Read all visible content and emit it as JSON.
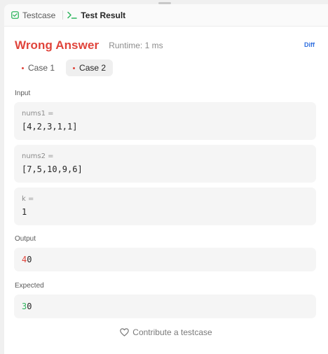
{
  "tabs": [
    {
      "label": "Testcase",
      "icon": "checkbox-icon",
      "active": false
    },
    {
      "label": "Test Result",
      "icon": "terminal-icon",
      "active": true
    }
  ],
  "result": {
    "status": "Wrong Answer",
    "runtime": "Runtime: 1 ms",
    "diff_label": "Diff"
  },
  "cases": [
    {
      "label": "Case 1",
      "active": false
    },
    {
      "label": "Case 2",
      "active": true
    }
  ],
  "input": {
    "label": "Input",
    "params": [
      {
        "name": "nums1 =",
        "value": "[4,2,3,1,1]"
      },
      {
        "name": "nums2 =",
        "value": "[7,5,10,9,6]"
      },
      {
        "name": "k =",
        "value": "1"
      }
    ]
  },
  "output": {
    "label": "Output",
    "diff_part": "4",
    "rest": "0"
  },
  "expected": {
    "label": "Expected",
    "diff_part": "3",
    "rest": "0"
  },
  "contribute": {
    "label": "Contribute a testcase",
    "icon": "heart-icon"
  },
  "colors": {
    "error": "#e0443b",
    "success": "#2db55d",
    "link": "#2f6fdf"
  }
}
